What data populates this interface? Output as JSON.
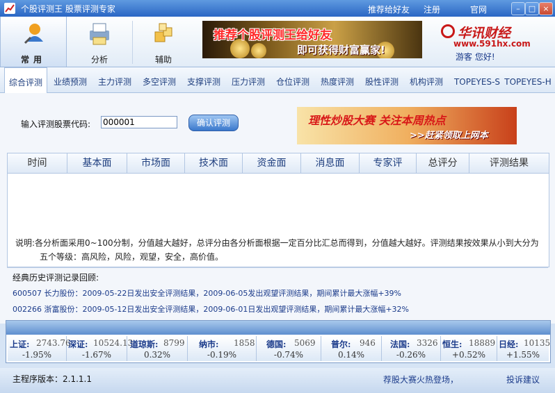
{
  "window": {
    "title": "个股评测王  股票评测专家",
    "links": [
      "推荐给好友",
      "注册",
      "官网"
    ]
  },
  "toolbar": {
    "items": [
      {
        "label": "常用",
        "icon": "magnifier-person-icon"
      },
      {
        "label": "分析",
        "icon": "printer-report-icon"
      },
      {
        "label": "辅助",
        "icon": "cubes-icon"
      }
    ]
  },
  "banner_top": {
    "line1": "推荐个股评测王给好友",
    "line2": "即可获得财富赢家!"
  },
  "logo": {
    "name": "华讯财经",
    "url": "www.591hx.com"
  },
  "user": {
    "greeting": "游客 您好!"
  },
  "tabs": [
    "综合评测",
    "业绩预测",
    "主力评测",
    "多空评测",
    "支撑评测",
    "压力评测",
    "仓位评测",
    "热度评测",
    "股性评测",
    "机构评测",
    "TOPEYES-S",
    "TOPEYES-H"
  ],
  "search": {
    "label": "输入评测股票代码:",
    "value": "000001",
    "button": "确认评测"
  },
  "banner_mid": {
    "line1": "理性炒股大赛  关注本周热点",
    "line2": ">>赶紧领取上网本"
  },
  "table": {
    "headers": [
      "时间",
      "基本面",
      "市场面",
      "技术面",
      "资金面",
      "消息面",
      "专家评",
      "总评分",
      "评测结果"
    ]
  },
  "note": {
    "line1": "说明:各分析面采用0~100分制，分值越大越好，总评分由各分析面根据一定百分比汇总而得到，分值越大越好。评测结果按效果从小到大分为",
    "line2": "五个等级：高风险，风险，观望，安全，高价值。"
  },
  "history": {
    "title": "经典历史评测记录回顾:",
    "rows": [
      "600507  长力股份：2009-05-22日发出安全评测结果，2009-06-05发出观望评测结果，期间累计最大涨幅+39%",
      "002266  浙富股份：2009-05-12日发出安全评测结果，2009-06-01日发出观望评测结果，期间累计最大涨幅+32%"
    ]
  },
  "indices": [
    {
      "name": "上证:",
      "value": "2743.76",
      "change": "-1.95%"
    },
    {
      "name": "深证:",
      "value": "10524.13",
      "change": "-1.67%"
    },
    {
      "name": "道琼斯:",
      "value": "8799",
      "change": "0.32%"
    },
    {
      "name": "纳市:",
      "value": "1858",
      "change": "-0.19%"
    },
    {
      "name": "德国:",
      "value": "5069",
      "change": "-0.74%"
    },
    {
      "name": "普尔:",
      "value": "946",
      "change": "0.14%"
    },
    {
      "name": "法国:",
      "value": "3326",
      "change": "-0.26%"
    },
    {
      "name": "恒生:",
      "value": "18889",
      "change": "+0.52%"
    },
    {
      "name": "日经:",
      "value": "10135",
      "change": "+1.55%"
    }
  ],
  "status": {
    "version_label": "主程序版本：2.1.1.1",
    "promo": "荐股大赛火热登场，",
    "feedback": "投诉建议"
  },
  "colors": {
    "accent": "#2a66c4",
    "link": "#1a3a8a",
    "brand_red": "#c81818"
  }
}
